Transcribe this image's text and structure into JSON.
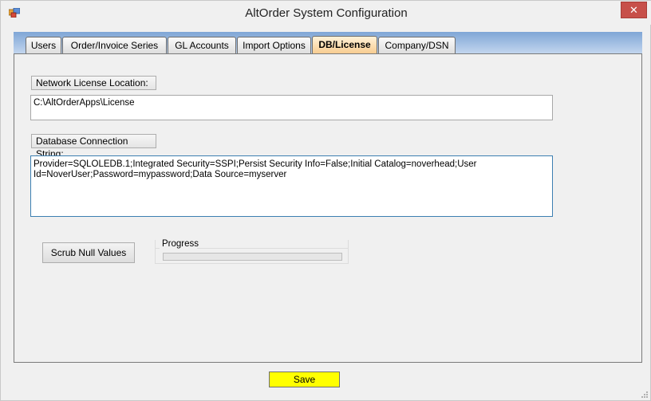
{
  "window": {
    "title": "AltOrder System Configuration",
    "close_glyph": "✕"
  },
  "tabs": [
    {
      "label": "Users",
      "active": false
    },
    {
      "label": "Order/Invoice Series",
      "active": false
    },
    {
      "label": "GL Accounts",
      "active": false
    },
    {
      "label": "Import Options",
      "active": false
    },
    {
      "label": "DB/License",
      "active": true
    },
    {
      "label": "Company/DSN",
      "active": false
    }
  ],
  "license": {
    "label": "Network License Location:",
    "value": "C:\\AltOrderApps\\License"
  },
  "database": {
    "label": "Database Connection String:",
    "value": "Provider=SQLOLEDB.1;Integrated Security=SSPI;Persist Security Info=False;Initial Catalog=noverhead;User Id=NoverUser;Password=mypassword;Data Source=myserver"
  },
  "scrub": {
    "button_label": "Scrub Null Values"
  },
  "progress": {
    "title": "Progress",
    "value": 0
  },
  "footer": {
    "save_label": "Save",
    "save_color": "#ffff00"
  },
  "colors": {
    "active_tab": "#f7c98a",
    "tabstrip": "#7fa6d6",
    "close": "#c7504a"
  }
}
